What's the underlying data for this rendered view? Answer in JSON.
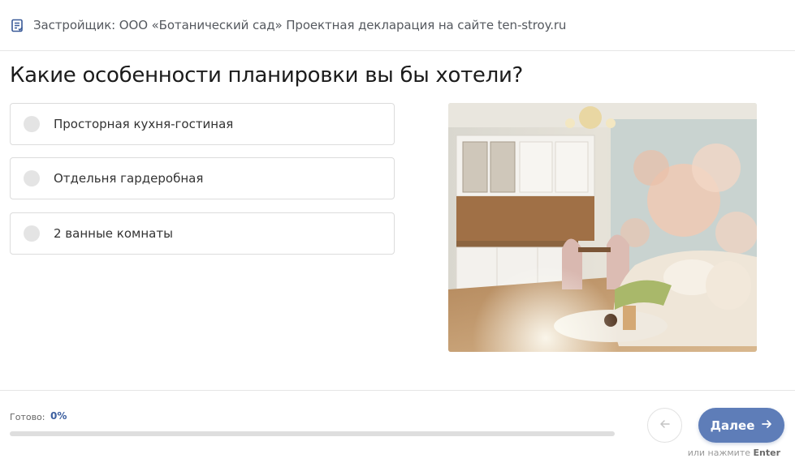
{
  "header": {
    "text": "Застройщик: ООО «Ботанический сад» Проектная декларация на сайте ten-stroy.ru",
    "icon": "document-check-icon"
  },
  "question": {
    "title": "Какие особенности планировки вы бы хотели?"
  },
  "options": [
    {
      "label": "Просторная кухня-гостиная",
      "selected": false
    },
    {
      "label": "Отдельня гардеробная",
      "selected": false
    },
    {
      "label": "2 ванные комнаты",
      "selected": false
    }
  ],
  "image": {
    "alt": "kitchen-living-room-interior"
  },
  "progress": {
    "label": "Готово:",
    "value_text": "0%",
    "value": 0
  },
  "navigation": {
    "back_icon": "arrow-left-icon",
    "next_label": "Далее",
    "next_icon": "arrow-right-icon",
    "hint_prefix": "или нажмите",
    "hint_key": "Enter"
  },
  "colors": {
    "accent": "#5e7db8",
    "progress_value": "#3c5fa0",
    "radio": "#e4e4e4"
  }
}
